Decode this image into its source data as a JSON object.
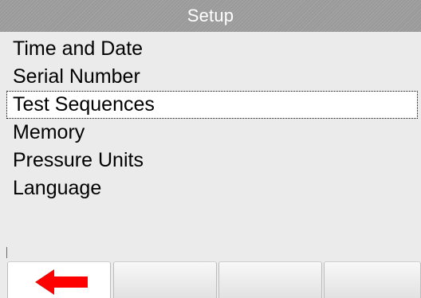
{
  "header": {
    "title": "Setup"
  },
  "menu": {
    "items": [
      {
        "label": "Time and Date",
        "selected": false
      },
      {
        "label": "Serial Number",
        "selected": false
      },
      {
        "label": "Test Sequences",
        "selected": true
      },
      {
        "label": "Memory",
        "selected": false
      },
      {
        "label": "Pressure Units",
        "selected": false
      },
      {
        "label": "Language",
        "selected": false
      }
    ]
  },
  "softkeys": [
    {
      "icon": "left-arrow-icon",
      "icon_color": "#ff0000"
    },
    {
      "icon": null
    },
    {
      "icon": null
    },
    {
      "icon": null
    }
  ],
  "colors": {
    "title_bar": "#9a9a9a",
    "menu_background": "#ebebeb",
    "selection_background": "#ffffff",
    "back_arrow": "#ff0000"
  }
}
